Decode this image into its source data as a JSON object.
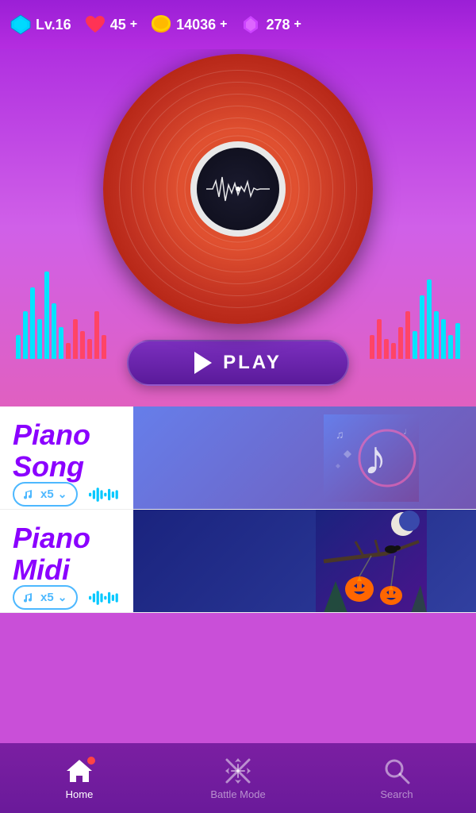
{
  "topbar": {
    "level_label": "Lv.16",
    "hearts": "45",
    "coins": "14036",
    "gems": "278",
    "plus_label": "+"
  },
  "play_button": {
    "label": "PLAY"
  },
  "songs": [
    {
      "id": "piano-song",
      "title": "Piano Song",
      "unlock_count": "x5",
      "thumbnail_type": "piano"
    },
    {
      "id": "piano-midi",
      "title": "Piano Midi",
      "unlock_count": "x5",
      "thumbnail_type": "midi"
    }
  ],
  "nav": {
    "home_label": "Home",
    "battle_label": "Battle Mode",
    "search_label": "Search"
  }
}
